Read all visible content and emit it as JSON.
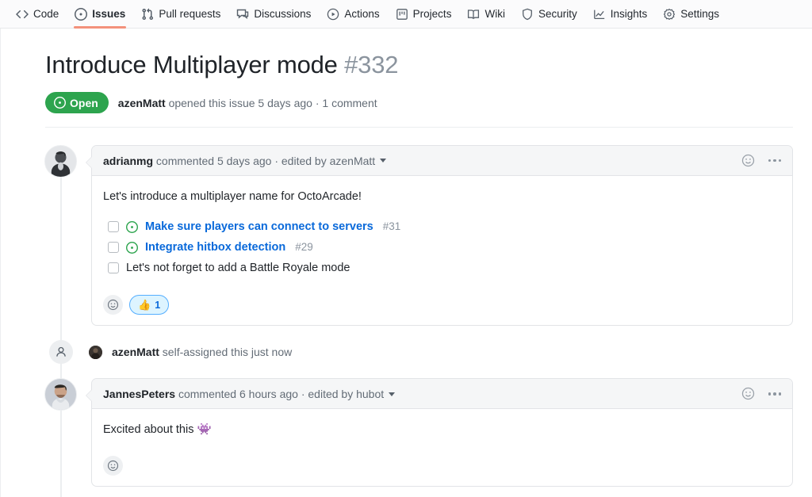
{
  "nav": {
    "tabs": [
      {
        "label": "Code",
        "icon": "code-icon",
        "active": false
      },
      {
        "label": "Issues",
        "icon": "issue-opened-icon",
        "active": true
      },
      {
        "label": "Pull requests",
        "icon": "git-pull-request-icon",
        "active": false
      },
      {
        "label": "Discussions",
        "icon": "comment-discussion-icon",
        "active": false
      },
      {
        "label": "Actions",
        "icon": "play-icon",
        "active": false
      },
      {
        "label": "Projects",
        "icon": "project-icon",
        "active": false
      },
      {
        "label": "Wiki",
        "icon": "book-icon",
        "active": false
      },
      {
        "label": "Security",
        "icon": "shield-icon",
        "active": false
      },
      {
        "label": "Insights",
        "icon": "graph-icon",
        "active": false
      },
      {
        "label": "Settings",
        "icon": "gear-icon",
        "active": false
      }
    ],
    "active_tab_underline_color": "#f3917b"
  },
  "issue": {
    "title": "Introduce Multiplayer mode",
    "number": "#332",
    "state_label": "Open",
    "state_color": "#2da44e",
    "state_icon": "issue-opened-icon",
    "meta_author": "azenMatt",
    "meta_action": "opened this issue 5 days ago",
    "meta_separator": "·",
    "meta_comments": "1 comment"
  },
  "comments": [
    {
      "author": "adrianmg",
      "action": "commented 5 days ago",
      "separator": "·",
      "edited_by": "edited by azenMatt",
      "caret_icon": "chevron-down-icon",
      "react_icon": "smiley-icon",
      "menu_icon": "kebab-horizontal-icon",
      "avatar": "avatar-adrianmg",
      "body_text": "Let's  introduce a multiplayer name for OctoArcade!",
      "tasks": [
        {
          "checked": false,
          "has_issue_icon": true,
          "text": "Make sure players can connect to servers",
          "ref": "#31",
          "is_link": true
        },
        {
          "checked": false,
          "has_issue_icon": true,
          "text": "Integrate hitbox detection",
          "ref": "#29",
          "is_link": true
        },
        {
          "checked": false,
          "has_issue_icon": false,
          "text": "Let's not forget to add a Battle Royale mode",
          "ref": "",
          "is_link": false
        }
      ],
      "reactions": {
        "add_icon": "smiley-plus-icon",
        "pills": [
          {
            "emoji": "👍",
            "count": "1"
          }
        ]
      }
    }
  ],
  "event": {
    "badge_icon": "person-icon",
    "avatar": "avatar-azenmatt",
    "author": "azenMatt",
    "text": "self-assigned this just now"
  },
  "comment2": {
    "author": "JannesPeters",
    "action": "commented 6 hours ago",
    "separator": "·",
    "edited_by": "edited by hubot",
    "caret_icon": "chevron-down-icon",
    "react_icon": "smiley-icon",
    "menu_icon": "kebab-horizontal-icon",
    "avatar": "avatar-jannespeters",
    "body_text": "Excited about this",
    "body_emoji": "👾",
    "reactions": {
      "add_icon": "smiley-plus-icon"
    }
  }
}
